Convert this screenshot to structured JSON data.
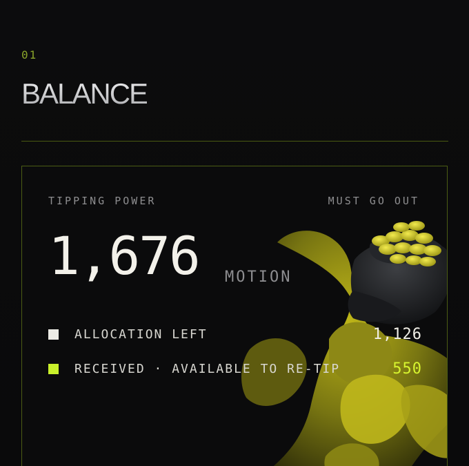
{
  "section": {
    "number": "01",
    "title": "BALANCE"
  },
  "card": {
    "left_label": "TIPPING POWER",
    "right_label": "MUST GO OUT",
    "total": "1,676",
    "unit": "MOTION",
    "rows": [
      {
        "label": "ALLOCATION LEFT",
        "value": "1,126",
        "swatch_color": "#ecebe5",
        "value_color": "#f1efe7"
      },
      {
        "label": "RECEIVED · AVAILABLE TO RE-TIP",
        "value": "550",
        "swatch_color": "#c9f02b",
        "value_color": "#d7f52f"
      }
    ]
  },
  "colors": {
    "accent": "#c9f02b",
    "border": "#4c5d14",
    "background": "#0b0b0c"
  },
  "artwork": {
    "icon": "pot-of-gold-icon"
  }
}
